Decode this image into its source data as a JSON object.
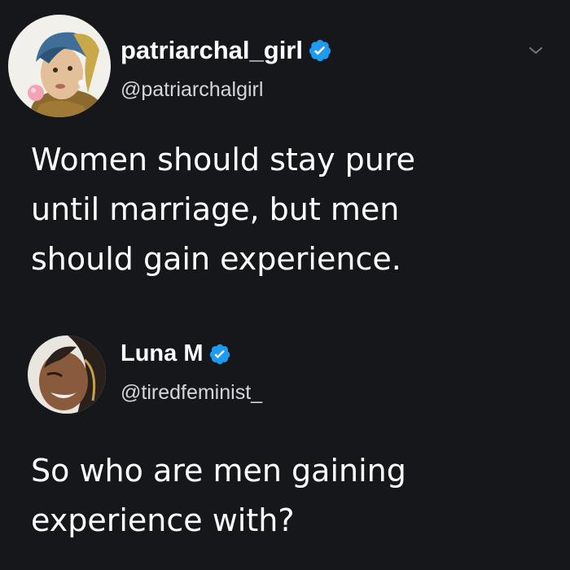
{
  "tweets": [
    {
      "display_name": "patriarchal_girl",
      "handle": "@patriarchalgirl",
      "verified": true,
      "avatar_icon": "girl-with-pearl-earring-avatar",
      "text_lines": [
        "Women should stay pure",
        "until marriage, but men",
        "should gain experience."
      ]
    },
    {
      "display_name": "Luna M",
      "handle": "@tiredfeminist_",
      "verified": true,
      "avatar_icon": "woman-smiling-avatar",
      "text_lines": [
        "So who are men gaining",
        "experience with?"
      ]
    }
  ],
  "colors": {
    "background": "#15171b",
    "text": "#ffffff",
    "handle": "#d4d6d9",
    "verified": "#1d9bf0",
    "more_icon": "#6e767d"
  }
}
